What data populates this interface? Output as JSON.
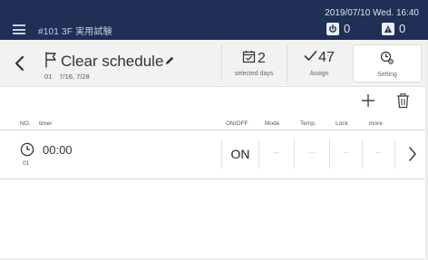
{
  "topbar": {
    "room": "#101 3F 実用試験",
    "datetime": "2019/07/10 Wed. 16:40",
    "power_count": "0",
    "alert_count": "0"
  },
  "header": {
    "title": "Clear schedule",
    "number": "01",
    "dates": "7/16, 7/28",
    "selected_days_count": "2",
    "selected_days_label": "selected days",
    "assign_count": "47",
    "assign_label": "Assign",
    "setting_label": "Setting"
  },
  "columns": {
    "no": "NO.",
    "timer": "timer",
    "onoff": "ON/OFF",
    "mode": "Mode",
    "temp": "Temp.",
    "lock": "Lock",
    "more": "more"
  },
  "rows": [
    {
      "no": "01",
      "time": "00:00",
      "onoff": "ON",
      "mode": "---",
      "temp": "---",
      "lock": "---",
      "more": "---"
    }
  ],
  "colors": {
    "topbar": "#1f2f55",
    "header": "#f2f2f2"
  }
}
